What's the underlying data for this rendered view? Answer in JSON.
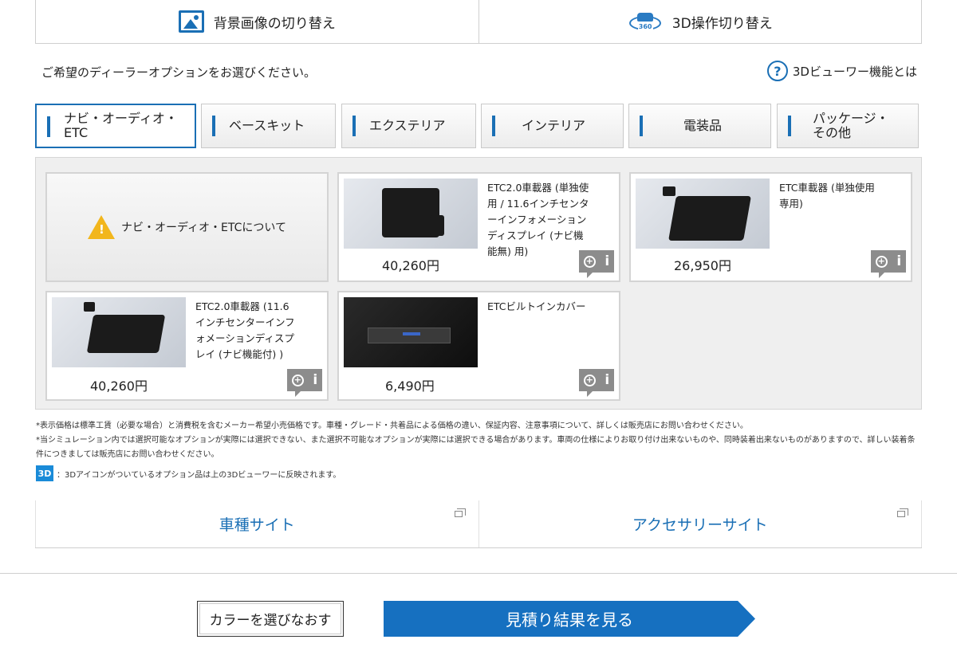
{
  "toggles": {
    "background": "背景画像の切り替え",
    "operation3d": "3D操作切り替え",
    "icon_360_text": "360"
  },
  "intro_text": "ご希望のディーラーオプションをお選びください。",
  "help": {
    "label": "3Dビューワー機能とは",
    "icon": "?"
  },
  "tabs": [
    {
      "label": "ナビ・オーディオ・ETC",
      "active": true
    },
    {
      "label": "ベースキット"
    },
    {
      "label": "エクステリア"
    },
    {
      "label": "インテリア"
    },
    {
      "label": "電装品"
    },
    {
      "label": "パッケージ・その他"
    }
  ],
  "info_card": {
    "label": "ナビ・オーディオ・ETCについて",
    "icon": "warning-icon"
  },
  "products": [
    {
      "name": "ETC2.0車載器 (単独使用 / 11.6インチセンターインフォメーションディスプレイ (ナビ機能無) 用)",
      "price": "40,260円"
    },
    {
      "name": "ETC車載器 (単独使用専用)",
      "price": "26,950円"
    },
    {
      "name": "ETC2.0車載器 (11.6インチセンターインフォメーションディスプレイ (ナビ機能付) )",
      "price": "40,260円"
    },
    {
      "name": "ETCビルトインカバー",
      "price": "6,490円"
    }
  ],
  "notes": {
    "line1": "*表示価格は標準工賃（必要な場合）と消費税を含むメーカー希望小売価格です。車種・グレード・共着品による価格の違い、保証内容、注意事項について、詳しくは販売店にお問い合わせください。",
    "line2": "*当シミュレーション内では選択可能なオプションが実際には選択できない、また選択不可能なオプションが実際には選択できる場合があります。車両の仕様によりお取り付け出来ないものや、同時装着出来ないものがありますので、詳しい装着条件につきましては販売店にお問い合わせください。",
    "badge": "3D",
    "badge_text": "：3Dアイコンがついているオプション品は上の3Dビューワーに反映されます。"
  },
  "links": {
    "car_site": "車種サイト",
    "accessory_site": "アクセサリーサイト"
  },
  "buttons": {
    "recolor": "カラーを選びなおす",
    "estimate": "見積り結果を見る"
  },
  "colors": {
    "accent": "#1a6fb5",
    "estimate_button": "#1670c0",
    "badge_3d": "#1a8bd8",
    "warning": "#f2b61c"
  }
}
